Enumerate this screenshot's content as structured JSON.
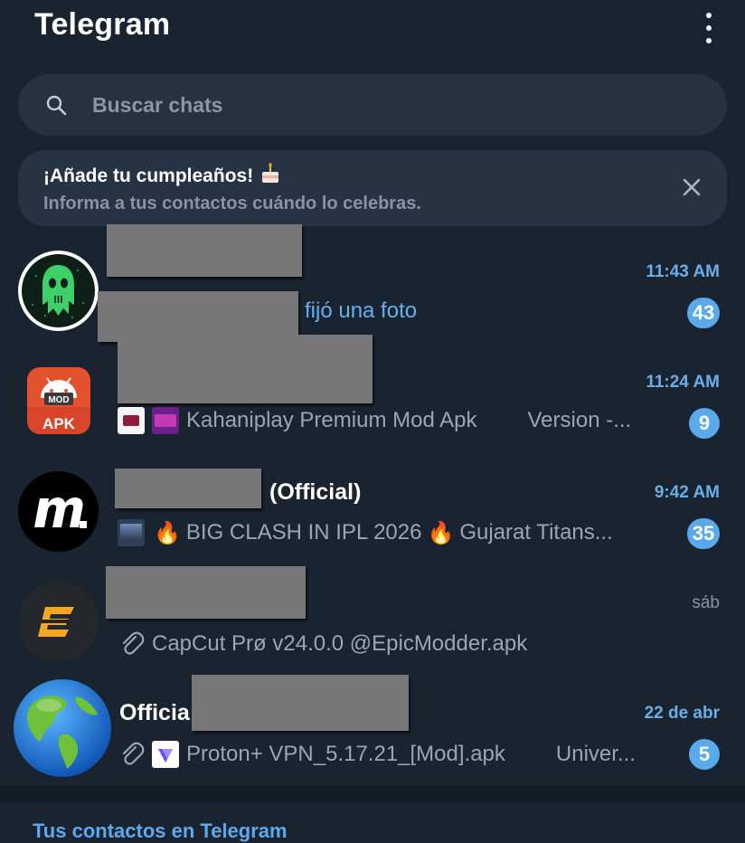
{
  "header": {
    "title": "Telegram",
    "menu_icon": "more-vertical-icon"
  },
  "search": {
    "placeholder": "Buscar chats",
    "icon": "search-icon"
  },
  "banner": {
    "title": "¡Añade tu cumpleaños!",
    "subtitle": "Informa a tus contactos cuándo lo celebras.",
    "emoji": "🎂",
    "close_icon": "close-icon"
  },
  "chats": [
    {
      "name": "",
      "time": "11:43 AM",
      "preview_suffix": "fijó una foto",
      "unread": "43"
    },
    {
      "name": "",
      "time": "11:24 AM",
      "preview": "Kahaniplay Premium Mod Apk",
      "preview_extra": "Version -...",
      "unread": "9"
    },
    {
      "name_suffix": "(Official)",
      "time": "9:42 AM",
      "preview": "BIG CLASH IN IPL 2026",
      "preview_extra": "Gujarat Titans...",
      "fire_emoji": "🔥",
      "unread": "35"
    },
    {
      "name": "",
      "time": "sáb",
      "preview": "CapCut Prø v24.0.0 @EpicModder.apk"
    },
    {
      "name_prefix": "Officia",
      "time": "22 de abr",
      "preview": "Proton+ VPN_5.17.21_[Mod].apk",
      "preview_extra": "Univer...",
      "unread": "5"
    }
  ],
  "contacts_section": {
    "title": "Tus contactos en Telegram"
  },
  "colors": {
    "background": "#1a2430",
    "accent": "#5aa9ea",
    "muted_text": "#9aa6b3"
  }
}
